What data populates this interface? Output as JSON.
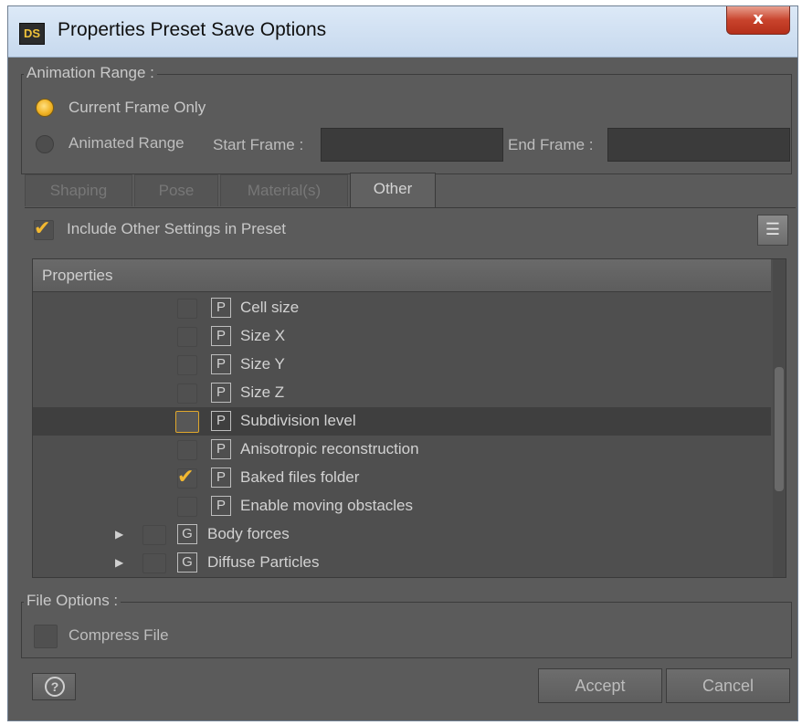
{
  "window": {
    "title": "Properties Preset Save Options",
    "app_icon_text": "DS",
    "close_glyph": "x"
  },
  "animation_range": {
    "legend": "Animation Range :",
    "current_frame_label": "Current Frame Only",
    "animated_range_label": "Animated Range",
    "start_frame_label": "Start Frame :",
    "end_frame_label": "End Frame :",
    "start_frame_value": "",
    "end_frame_value": "",
    "selected": "current_frame"
  },
  "tabs": [
    {
      "label": "Shaping",
      "active": false
    },
    {
      "label": "Pose",
      "active": false
    },
    {
      "label": "Material(s)",
      "active": false
    },
    {
      "label": "Other",
      "active": true
    }
  ],
  "include_settings": {
    "label": "Include Other Settings in Preset",
    "checked": true,
    "menu_icon": "list-menu-icon"
  },
  "properties_tree": {
    "header": "Properties",
    "rows": [
      {
        "label": "Cell size",
        "type": "P",
        "checked": false
      },
      {
        "label": "Size X",
        "type": "P",
        "checked": false
      },
      {
        "label": "Size Y",
        "type": "P",
        "checked": false
      },
      {
        "label": "Size Z",
        "type": "P",
        "checked": false
      },
      {
        "label": "Subdivision level",
        "type": "P",
        "checked": false,
        "selected": true
      },
      {
        "label": "Anisotropic reconstruction",
        "type": "P",
        "checked": false
      },
      {
        "label": "Baked files folder",
        "type": "P",
        "checked": true
      },
      {
        "label": "Enable moving obstacles",
        "type": "P",
        "checked": false
      },
      {
        "label": "Body forces",
        "type": "G",
        "checked": false,
        "expandable": true
      },
      {
        "label": "Diffuse Particles",
        "type": "G",
        "checked": false,
        "expandable": true
      }
    ]
  },
  "file_options": {
    "legend": "File Options :",
    "compress_label": "Compress File",
    "compress_checked": false
  },
  "buttons": {
    "help": "?",
    "accept": "Accept",
    "cancel": "Cancel"
  },
  "colors": {
    "accent": "#f2b830",
    "panel": "#5b5b5b",
    "title_bar": "#dce9f7",
    "close": "#c8432c"
  }
}
